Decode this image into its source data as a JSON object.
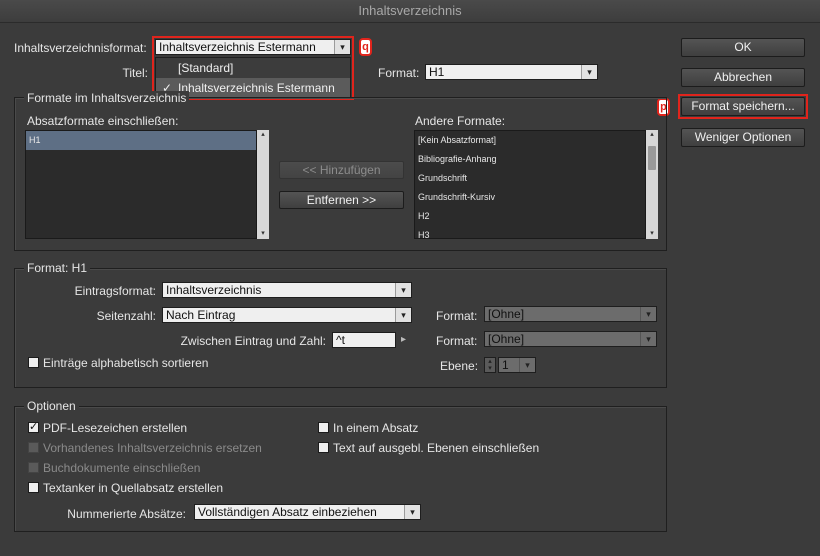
{
  "window": {
    "title": "Inhaltsverzeichnis"
  },
  "toc_style": {
    "label": "Inhaltsverzeichnisformat:",
    "value": "Inhaltsverzeichnis Estermann",
    "badge": "q",
    "options": [
      {
        "label": "[Standard]",
        "checked": false
      },
      {
        "label": "Inhaltsverzeichnis Estermann",
        "checked": true
      }
    ]
  },
  "title": {
    "label": "Titel:",
    "format_label": "Format:",
    "format_value": "H1"
  },
  "buttons": {
    "ok": "OK",
    "cancel": "Abbrechen",
    "save_style": "Format speichern...",
    "save_badge": "p",
    "fewer_options": "Weniger Optionen"
  },
  "styles_group": {
    "legend": "Formate im Inhaltsverzeichnis",
    "include_label": "Absatzformate einschließen:",
    "included": [
      "H1"
    ],
    "other_label": "Andere Formate:",
    "other": [
      "[Kein Absatzformat]",
      "Bibliografie-Anhang",
      "Grundschrift",
      "Grundschrift-Kursiv",
      "H2",
      "H3"
    ],
    "add": "<< Hinzufügen",
    "remove": "Entfernen >>"
  },
  "style_h1": {
    "legend": "Format: H1",
    "entry_style_label": "Eintragsformat:",
    "entry_style_value": "Inhaltsverzeichnis",
    "page_number_label": "Seitenzahl:",
    "page_number_value": "Nach Eintrag",
    "page_format_label": "Format:",
    "page_format_value": "[Ohne]",
    "between_label": "Zwischen Eintrag und Zahl:",
    "between_value": "^t",
    "between_format_label": "Format:",
    "between_format_value": "[Ohne]",
    "sort_label": "Einträge alphabetisch sortieren",
    "level_label": "Ebene:",
    "level_value": "1"
  },
  "options_group": {
    "legend": "Optionen",
    "pdf_bookmarks": "PDF-Lesezeichen erstellen",
    "replace_existing": "Vorhandenes Inhaltsverzeichnis ersetzen",
    "include_book": "Buchdokumente einschließen",
    "text_anchors": "Textanker in Quellabsatz erstellen",
    "run_in": "In einem Absatz",
    "hidden_layers": "Text auf ausgebl. Ebenen einschließen",
    "numbered_label": "Nummerierte Absätze:",
    "numbered_value": "Vollständigen Absatz einbeziehen"
  },
  "icons": {
    "check": "✓",
    "arrow_down": "▾",
    "arrow_up": "▴",
    "play": "▸"
  }
}
